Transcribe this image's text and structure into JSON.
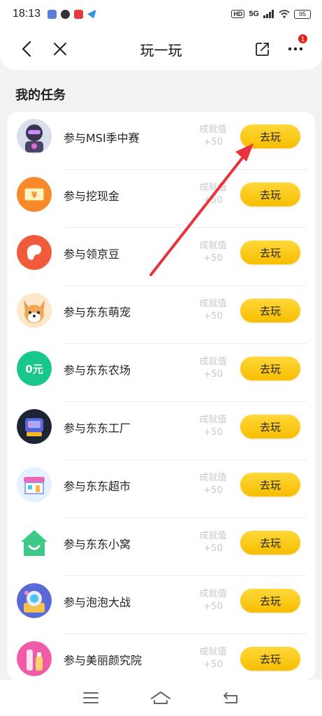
{
  "status_bar": {
    "time": "18:13",
    "network": "5G",
    "battery": "95"
  },
  "nav": {
    "title": "玩一玩",
    "notification_count": "1"
  },
  "section_title": "我的任务",
  "tasks": [
    {
      "name": "参与MSI季中赛",
      "reward_label": "成就值",
      "reward_value": "+50",
      "button": "去玩",
      "icon": "msi-robot-icon"
    },
    {
      "name": "参与挖现金",
      "reward_label": "成就值",
      "reward_value": "+50",
      "button": "去玩",
      "icon": "cash-yen-icon"
    },
    {
      "name": "参与领京豆",
      "reward_label": "成就值",
      "reward_value": "+50",
      "button": "去玩",
      "icon": "jingdou-bean-icon"
    },
    {
      "name": "参与东东萌宠",
      "reward_label": "成就值",
      "reward_value": "+50",
      "button": "去玩",
      "icon": "corgi-pet-icon"
    },
    {
      "name": "参与东东农场",
      "reward_label": "成就值",
      "reward_value": "+50",
      "button": "去玩",
      "icon": "farm-zero-yuan-icon"
    },
    {
      "name": "参与东东工厂",
      "reward_label": "成就值",
      "reward_value": "+50",
      "button": "去玩",
      "icon": "factory-machine-icon"
    },
    {
      "name": "参与东东超市",
      "reward_label": "成就值",
      "reward_value": "+50",
      "button": "去玩",
      "icon": "supermarket-icon"
    },
    {
      "name": "参与东东小窝",
      "reward_label": "成就值",
      "reward_value": "+50",
      "button": "去玩",
      "icon": "house-smile-icon"
    },
    {
      "name": "参与泡泡大战",
      "reward_label": "成就值",
      "reward_value": "+50",
      "button": "去玩",
      "icon": "bubble-battle-icon"
    },
    {
      "name": "参与美丽颜究院",
      "reward_label": "成就值",
      "reward_value": "+50",
      "button": "去玩",
      "icon": "cosmetics-bottle-icon"
    }
  ],
  "colors": {
    "button_yellow": "#fcc800",
    "annotation_arrow": "#e8333d",
    "badge_red": "#e2231a"
  }
}
